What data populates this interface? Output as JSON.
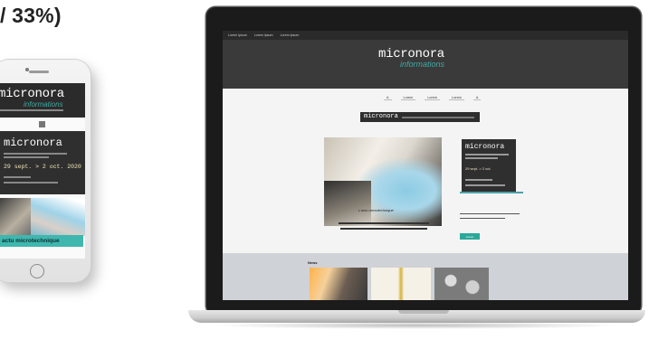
{
  "heading": "/ 33%)",
  "phone": {
    "logo": "micronora",
    "logo_sub": "informations",
    "hero_logo": "micronora",
    "hero_date": "29 sept. > 2 oct. 2020",
    "banner_text": "actu microtechnique"
  },
  "laptop": {
    "top_links": [
      "Lorem ipsum",
      "Lorem ipsum",
      "Lorem ipsum"
    ],
    "logo": "micronora",
    "logo_sub": "informations",
    "nav": [
      "A",
      "Lorem",
      "Lorem",
      "Lorem",
      "A"
    ],
    "ad_logo": "micronora",
    "side_logo": "micronora",
    "side_date": "29 sept. > 2 oct.",
    "caption": "L'actu microtechnique",
    "news_title": "News",
    "button_label": "Lorem"
  }
}
